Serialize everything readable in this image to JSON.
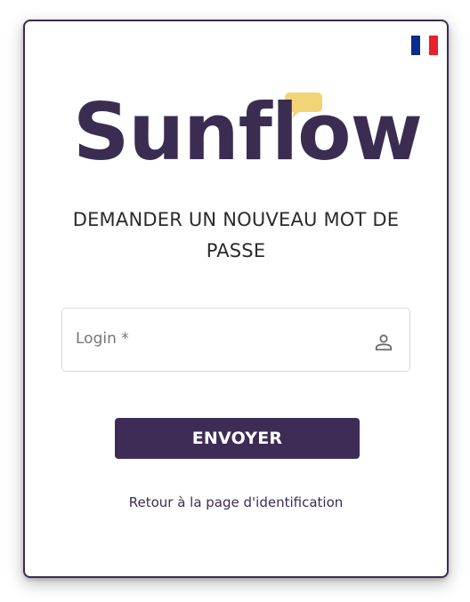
{
  "language": {
    "flag": "france",
    "colors": [
      "#0a2c8c",
      "#ffffff",
      "#e8202b"
    ]
  },
  "logo": {
    "text": "Sunflow",
    "text_color": "#3b2d52",
    "bubble_color": "#f2d376"
  },
  "heading": "DEMANDER UN NOUVEAU MOT DE PASSE",
  "login_field": {
    "label": "Login *",
    "value": "",
    "icon": "person-icon"
  },
  "submit_button": {
    "label": "ENVOYER",
    "color": "#3d2c55"
  },
  "back_link": "Retour à la page d'identification"
}
